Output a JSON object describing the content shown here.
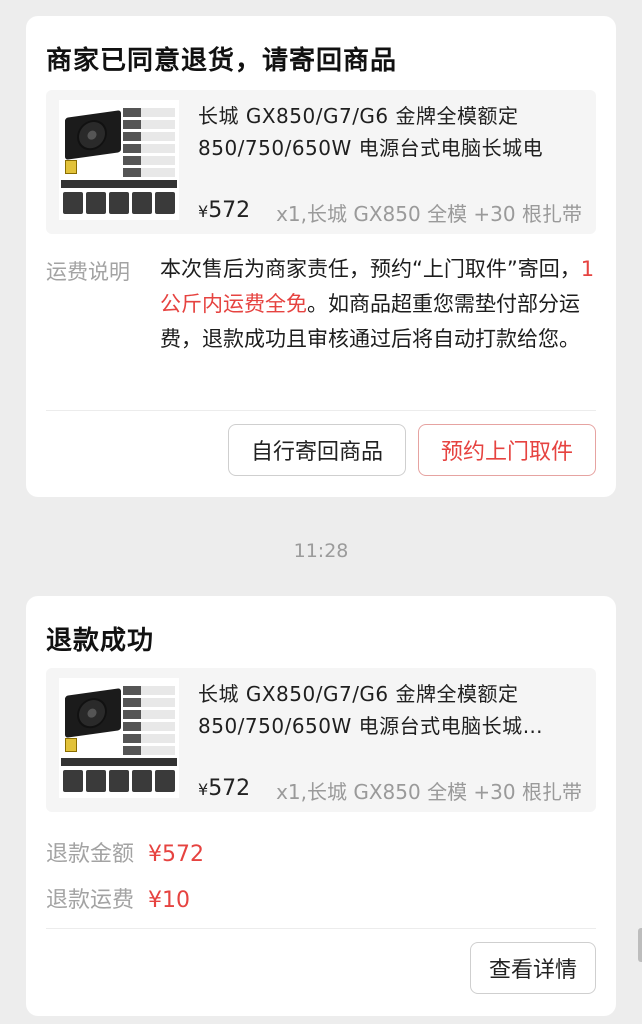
{
  "card1": {
    "title": "商家已同意退货，请寄回商品",
    "product": {
      "name": "长城 GX850/G7/G6 金牌全模额定 850/750/650W 电源台式电脑长城电",
      "currency": "¥",
      "price": "572",
      "sku": "x1,长城 GX850 全模 +30 根扎带"
    },
    "shipping": {
      "label": "运费说明",
      "text_before": "本次售后为商家责任，预约“上门取件”寄回，",
      "highlight": "1公斤内运费全免",
      "text_after": "。如商品超重您需垫付部分运费，退款成功且审核通过后将自动打款给您。"
    },
    "buttons": {
      "self_return": "自行寄回商品",
      "pickup": "预约上门取件"
    }
  },
  "timestamp": "11:28",
  "card2": {
    "title": "退款成功",
    "product": {
      "name": "长城 GX850/G7/G6 金牌全模额定 850/750/650W 电源台式电脑长城…",
      "currency": "¥",
      "price": "572",
      "sku": "x1,长城 GX850 全模 +30 根扎带"
    },
    "refund_amount": {
      "label": "退款金额",
      "value": "¥572"
    },
    "refund_shipping": {
      "label": "退款运费",
      "value": "¥10"
    },
    "buttons": {
      "details": "查看详情"
    }
  },
  "colors": {
    "accent_red": "#e64340",
    "muted_gray": "#a3a3a3",
    "background": "#ededed"
  }
}
